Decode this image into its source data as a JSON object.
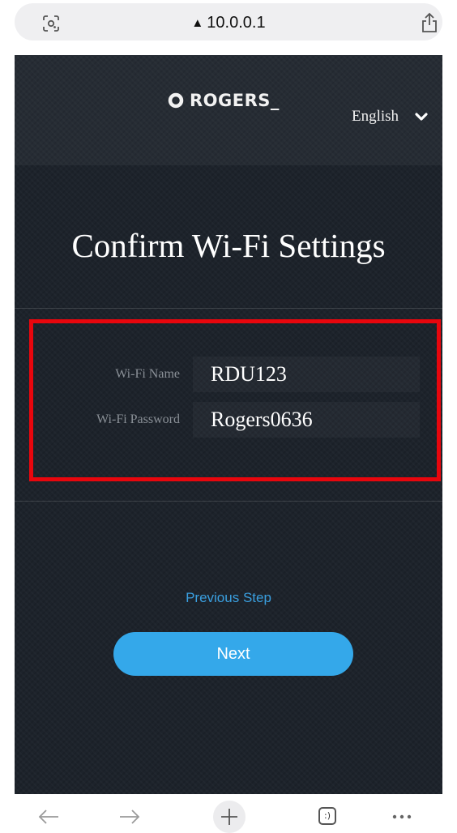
{
  "browser": {
    "url": "10.0.0.1",
    "secure_icon": "warning-triangle-icon",
    "lens_icon": "lens-scan-icon",
    "share_icon": "share-icon",
    "toolbar": {
      "back_icon": "arrow-left-icon",
      "forward_icon": "arrow-right-icon",
      "new_tab_icon": "plus-icon",
      "tabs_label": ":)",
      "more_icon": "ellipsis-icon"
    }
  },
  "router": {
    "brand": "ROGERS",
    "language": "English",
    "title": "Confirm Wi-Fi Settings",
    "fields": [
      {
        "label": "Wi-Fi Name",
        "value": "RDU123"
      },
      {
        "label": "Wi-Fi Password",
        "value": "Rogers0636"
      }
    ],
    "previous_label": "Previous Step",
    "next_label": "Next"
  },
  "colors": {
    "page_background": "#1d232b",
    "accent": "#34a8ea",
    "link": "#3a9fdf",
    "highlight": "#e8060d"
  }
}
